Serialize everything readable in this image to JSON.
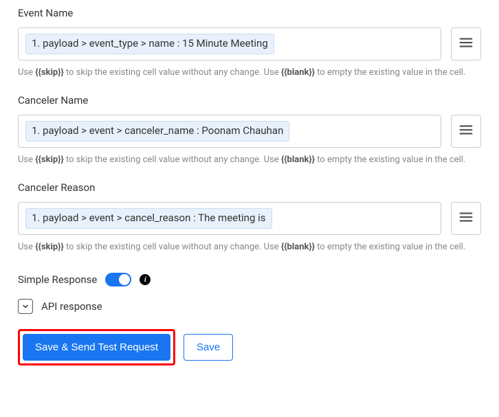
{
  "fields": [
    {
      "label": "Event Name",
      "token": "1. payload > event_type > name : 15 Minute Meeting"
    },
    {
      "label": "Canceler Name",
      "token": "1. payload > event > canceler_name : Poonam Chauhan"
    },
    {
      "label": "Canceler Reason",
      "token": "1. payload > event > cancel_reason : The meeting is"
    }
  ],
  "help": {
    "prefix": "Use ",
    "skip_tag": "{{skip}}",
    "middle": " to skip the existing cell value without any change. Use ",
    "blank_tag": "{{blank}}",
    "suffix": " to empty the existing value in the cell."
  },
  "simple_response_label": "Simple Response",
  "api_response_label": "API response",
  "buttons": {
    "save_send": "Save & Send Test Request",
    "save": "Save"
  }
}
